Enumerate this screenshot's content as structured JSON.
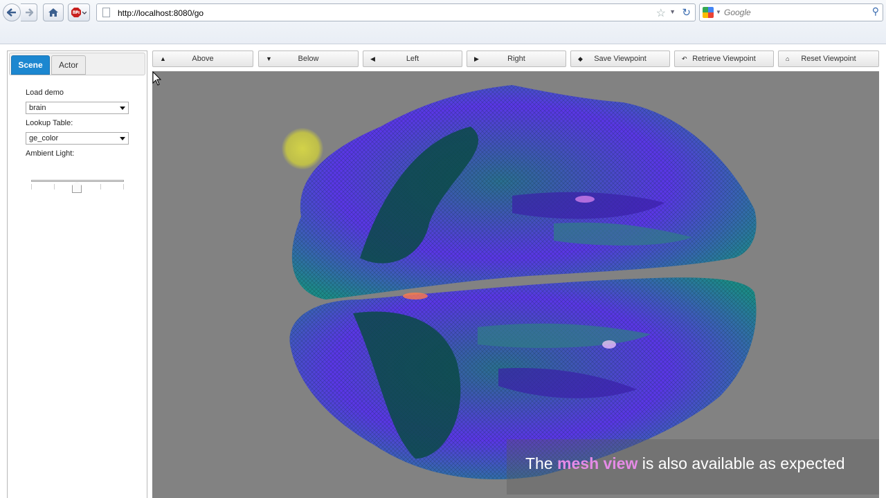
{
  "browser": {
    "url": "http://localhost:8080/go",
    "search_placeholder": "Google"
  },
  "sidebar": {
    "tabs": [
      {
        "label": "Scene",
        "active": true
      },
      {
        "label": "Actor",
        "active": false
      }
    ],
    "load_demo_label": "Load demo",
    "load_demo_value": "brain",
    "lookup_table_label": "Lookup Table:",
    "lookup_table_value": "ge_color",
    "ambient_light_label": "Ambient Light:",
    "ambient_light_value": 0.5
  },
  "toolbar": {
    "buttons": [
      {
        "label": "Above",
        "icon": "triangle-up-icon"
      },
      {
        "label": "Below",
        "icon": "triangle-down-icon"
      },
      {
        "label": "Left",
        "icon": "triangle-left-icon"
      },
      {
        "label": "Right",
        "icon": "triangle-right-icon"
      },
      {
        "label": "Save Viewpoint",
        "icon": "tag-icon"
      },
      {
        "label": "Retrieve Viewpoint",
        "icon": "undo-arrow-icon"
      },
      {
        "label": "Reset Viewpoint",
        "icon": "home-icon"
      }
    ]
  },
  "caption": {
    "prefix": "The ",
    "highlight": "mesh view",
    "suffix": " is also available as expected"
  },
  "colors": {
    "accent": "#1c87d0",
    "viewport_bg": "#828282",
    "mesh_teal": "#0f8a7f",
    "mesh_purple": "#6a2ff0",
    "caption_highlight": "#e58be6"
  }
}
